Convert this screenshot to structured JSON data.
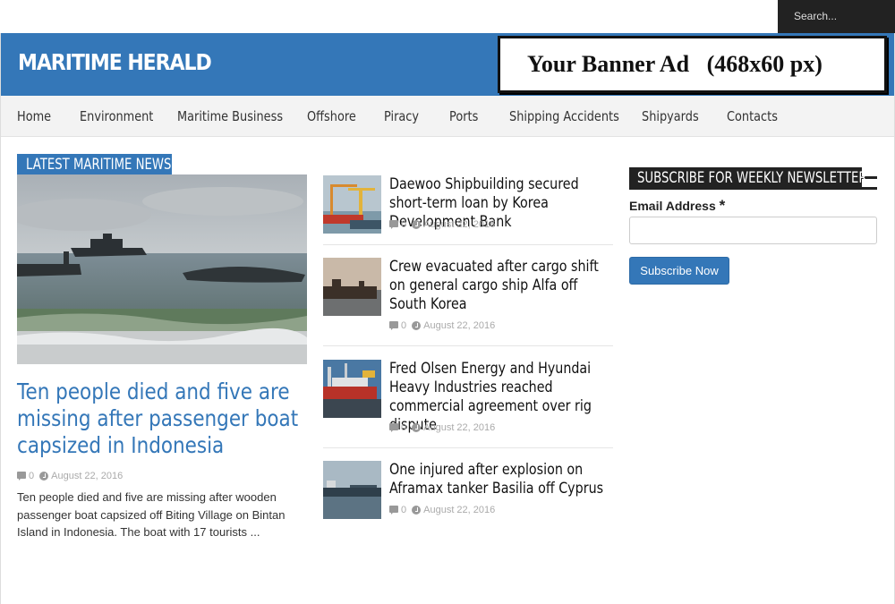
{
  "search": {
    "placeholder": "Search..."
  },
  "header": {
    "site_title": "MARITIME HERALD",
    "banner_text": "Your Banner Ad   (468x60 px)",
    "brand_color": "#3477b8"
  },
  "nav": {
    "items": [
      {
        "label": "Home"
      },
      {
        "label": "Environment"
      },
      {
        "label": "Maritime Business"
      },
      {
        "label": "Offshore"
      },
      {
        "label": "Piracy"
      },
      {
        "label": "Ports"
      },
      {
        "label": "Shipping Accidents"
      },
      {
        "label": "Shipyards"
      },
      {
        "label": "Contacts"
      }
    ]
  },
  "latest": {
    "heading": "LATEST MARITIME NEWS",
    "featured": {
      "title": "Ten people died and five are missing after passenger boat capsized in Indonesia",
      "comments": "0",
      "date": "August 22, 2016",
      "excerpt": "Ten people died and five are missing after wooden passenger boat capsized off Biting Village on Bintan Island in Indonesia. The boat with 17 tourists ..."
    },
    "items": [
      {
        "title": "Daewoo Shipbuilding secured short-term loan by Korea Development Bank",
        "comments": "0",
        "date": "August 22, 2016"
      },
      {
        "title": "Crew evacuated after cargo shift on general cargo ship Alfa off South Korea",
        "comments": "0",
        "date": "August 22, 2016"
      },
      {
        "title": "Fred Olsen Energy and Hyundai Heavy Industries reached commercial agreement over rig dispute",
        "comments": "0",
        "date": "August 22, 2016"
      },
      {
        "title": "One injured after explosion on Aframax tanker Basilia off Cyprus",
        "comments": "0",
        "date": "August 22, 2016"
      }
    ]
  },
  "newsletter": {
    "heading": "SUBSCRIBE FOR WEEKLY NEWSLETTER",
    "email_label": "Email Address",
    "required_mark": "*",
    "button_label": "Subscribe Now"
  }
}
